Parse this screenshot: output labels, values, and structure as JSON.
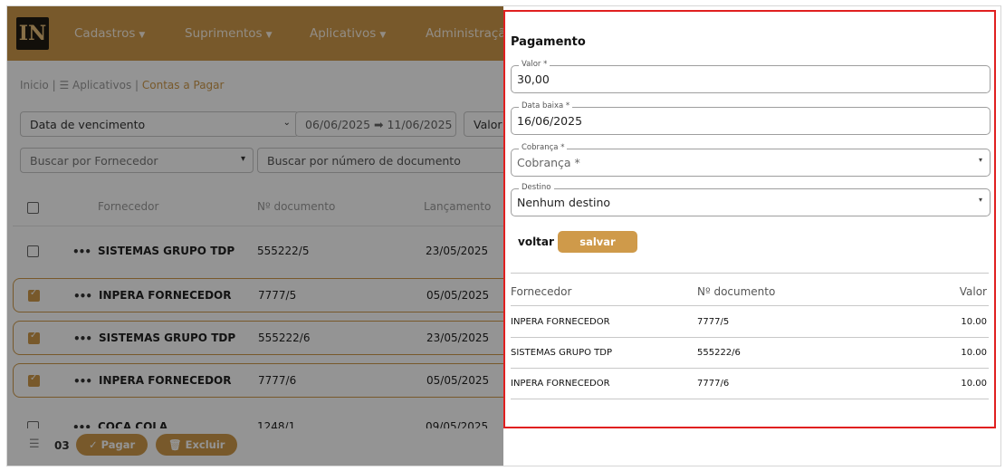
{
  "app": {
    "logo_text": "IN",
    "nav": [
      "Cadastros",
      "Suprimentos",
      "Aplicativos",
      "Administração"
    ],
    "breadcrumb": {
      "home": "Inicio |",
      "apps": "☰ Aplicativos |",
      "current": "Contas a Pagar"
    },
    "filters": {
      "date_field": "Data de vencimento",
      "date_range": "06/06/2025 ➡ 11/06/2025",
      "value_field": "Valor i",
      "supplier_search": "Buscar por Fornecedor",
      "document_search": "Buscar por número de documento"
    },
    "columns": [
      "Fornecedor",
      "Nº documento",
      "Lançamento"
    ],
    "rows": [
      {
        "supplier": "SISTEMAS GRUPO TDP",
        "document": "555222/5",
        "date": "23/05/2025",
        "selected": false
      },
      {
        "supplier": "INPERA FORNECEDOR",
        "document": "7777/5",
        "date": "05/05/2025",
        "selected": true
      },
      {
        "supplier": "SISTEMAS GRUPO TDP",
        "document": "555222/6",
        "date": "23/05/2025",
        "selected": true
      },
      {
        "supplier": "INPERA FORNECEDOR",
        "document": "7777/6",
        "date": "05/05/2025",
        "selected": true
      },
      {
        "supplier": "COCA COLA",
        "document": "1248/1",
        "date": "09/05/2025",
        "selected": false
      }
    ],
    "row_menu": "•••",
    "bottom": {
      "selected_count": "03",
      "pay_label": "✓  Pagar",
      "delete_label": "🗑  Excluir"
    }
  },
  "payment": {
    "title": "Pagamento",
    "fields": {
      "valor": {
        "label": "Valor *",
        "value": "30,00"
      },
      "data_baixa": {
        "label": "Data baixa *",
        "value": "16/06/2025"
      },
      "cobranca": {
        "label": "Cobrança *",
        "value": "Cobrança *"
      },
      "destino": {
        "label": "Destino",
        "value": "Nenhum destino"
      }
    },
    "back_label": "voltar",
    "save_label": "salvar",
    "table": {
      "headers": [
        "Fornecedor",
        "Nº documento",
        "Valor"
      ],
      "rows": [
        {
          "supplier": "INPERA FORNECEDOR",
          "document": "7777/5",
          "value": "10.00"
        },
        {
          "supplier": "SISTEMAS GRUPO TDP",
          "document": "555222/6",
          "value": "10.00"
        },
        {
          "supplier": "INPERA FORNECEDOR",
          "document": "7777/6",
          "value": "10.00"
        }
      ]
    }
  },
  "colors": {
    "brand": "#cf9a4a",
    "highlight_border": "#e02020"
  }
}
